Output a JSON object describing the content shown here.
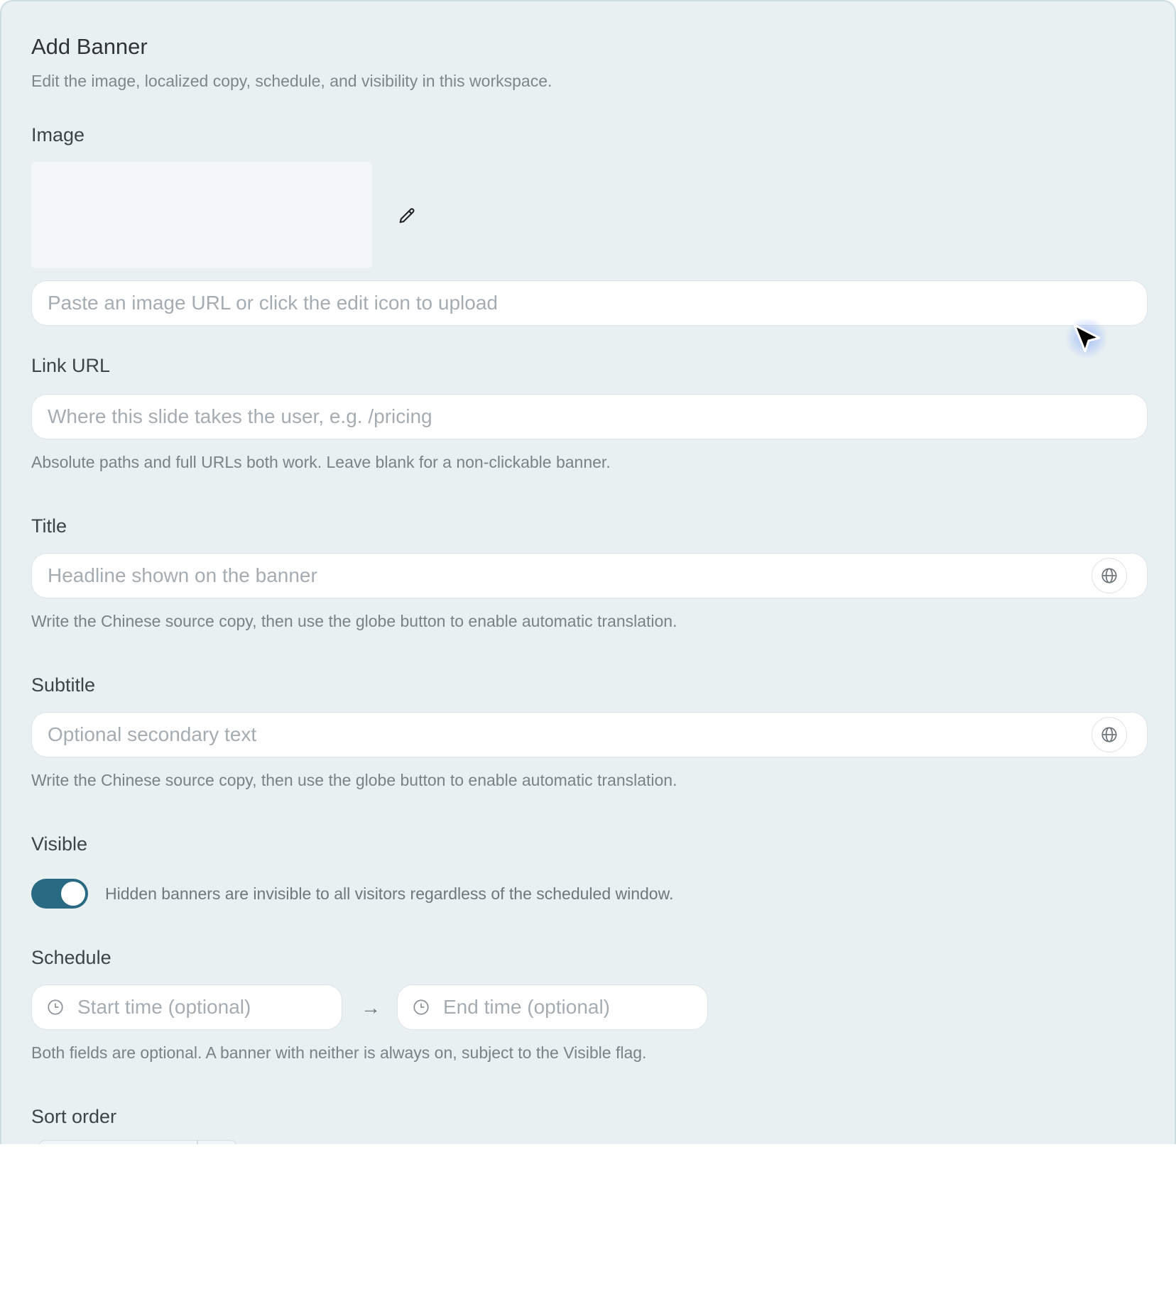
{
  "form": {
    "title": "Add Banner",
    "description": "Edit the image, localized copy, schedule, and visibility in this workspace."
  },
  "image": {
    "label": "Image",
    "url_placeholder": "Paste an image URL or click the edit icon to upload",
    "edit_icon": "pencil-icon"
  },
  "link": {
    "label": "Link URL",
    "placeholder": "Where this slide takes the user, e.g. /pricing",
    "hint": "Absolute paths and full URLs both work. Leave blank for a non-clickable banner."
  },
  "title_field": {
    "label": "Title",
    "placeholder": "Headline shown on the banner",
    "hint": "Write the Chinese source copy, then use the globe button to enable automatic translation.",
    "translate_icon": "globe-icon"
  },
  "subtitle_field": {
    "label": "Subtitle",
    "placeholder": "Optional secondary text",
    "hint": "Write the Chinese source copy, then use the globe button to enable automatic translation.",
    "translate_icon": "globe-icon"
  },
  "visible": {
    "label": "Visible",
    "enabled": true,
    "hint": "Hidden banners are invisible to all visitors regardless of the scheduled window."
  },
  "schedule": {
    "label": "Schedule",
    "start_placeholder": "Start time (optional)",
    "end_placeholder": "End time (optional)",
    "separator": "→",
    "hint": "Both fields are optional. A banner with neither is always on, subject to the Visible flag.",
    "icon": "clock-icon"
  },
  "sort": {
    "label": "Sort order"
  },
  "colors": {
    "panel_background": "#e9f0f2",
    "toggle_on": "#276a81",
    "input_background": "#ffffff",
    "placeholder_text": "#a6adb2"
  }
}
